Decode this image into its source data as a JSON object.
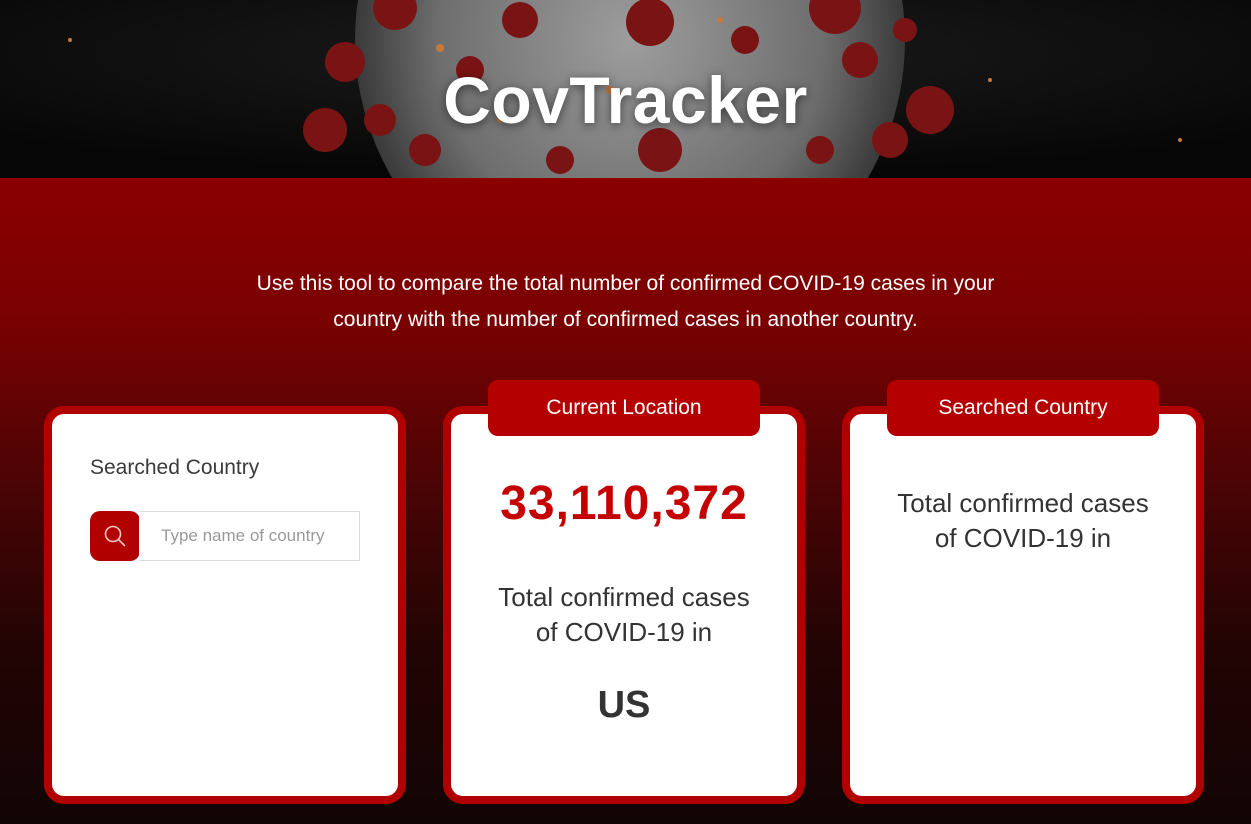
{
  "header": {
    "title": "CovTracker"
  },
  "intro": {
    "line1": "Use this tool to compare the total number of confirmed COVID-19 cases in your",
    "line2": "country with the number of confirmed cases in another country."
  },
  "search_card": {
    "label": "Searched Country",
    "placeholder": "Type name of country",
    "value": "",
    "icon": "search-icon"
  },
  "current_card": {
    "tab_label": "Current Location",
    "cases": "33,110,372",
    "text_line1": "Total confirmed cases",
    "text_line2": "of COVID-19 in",
    "country": "US"
  },
  "searched_card": {
    "tab_label": "Searched Country",
    "text_line1": "Total confirmed cases",
    "text_line2": "of COVID-19 in",
    "country": ""
  },
  "colors": {
    "accent": "#b00000",
    "number": "#c40000",
    "header_bg": "#0b0b0b"
  }
}
